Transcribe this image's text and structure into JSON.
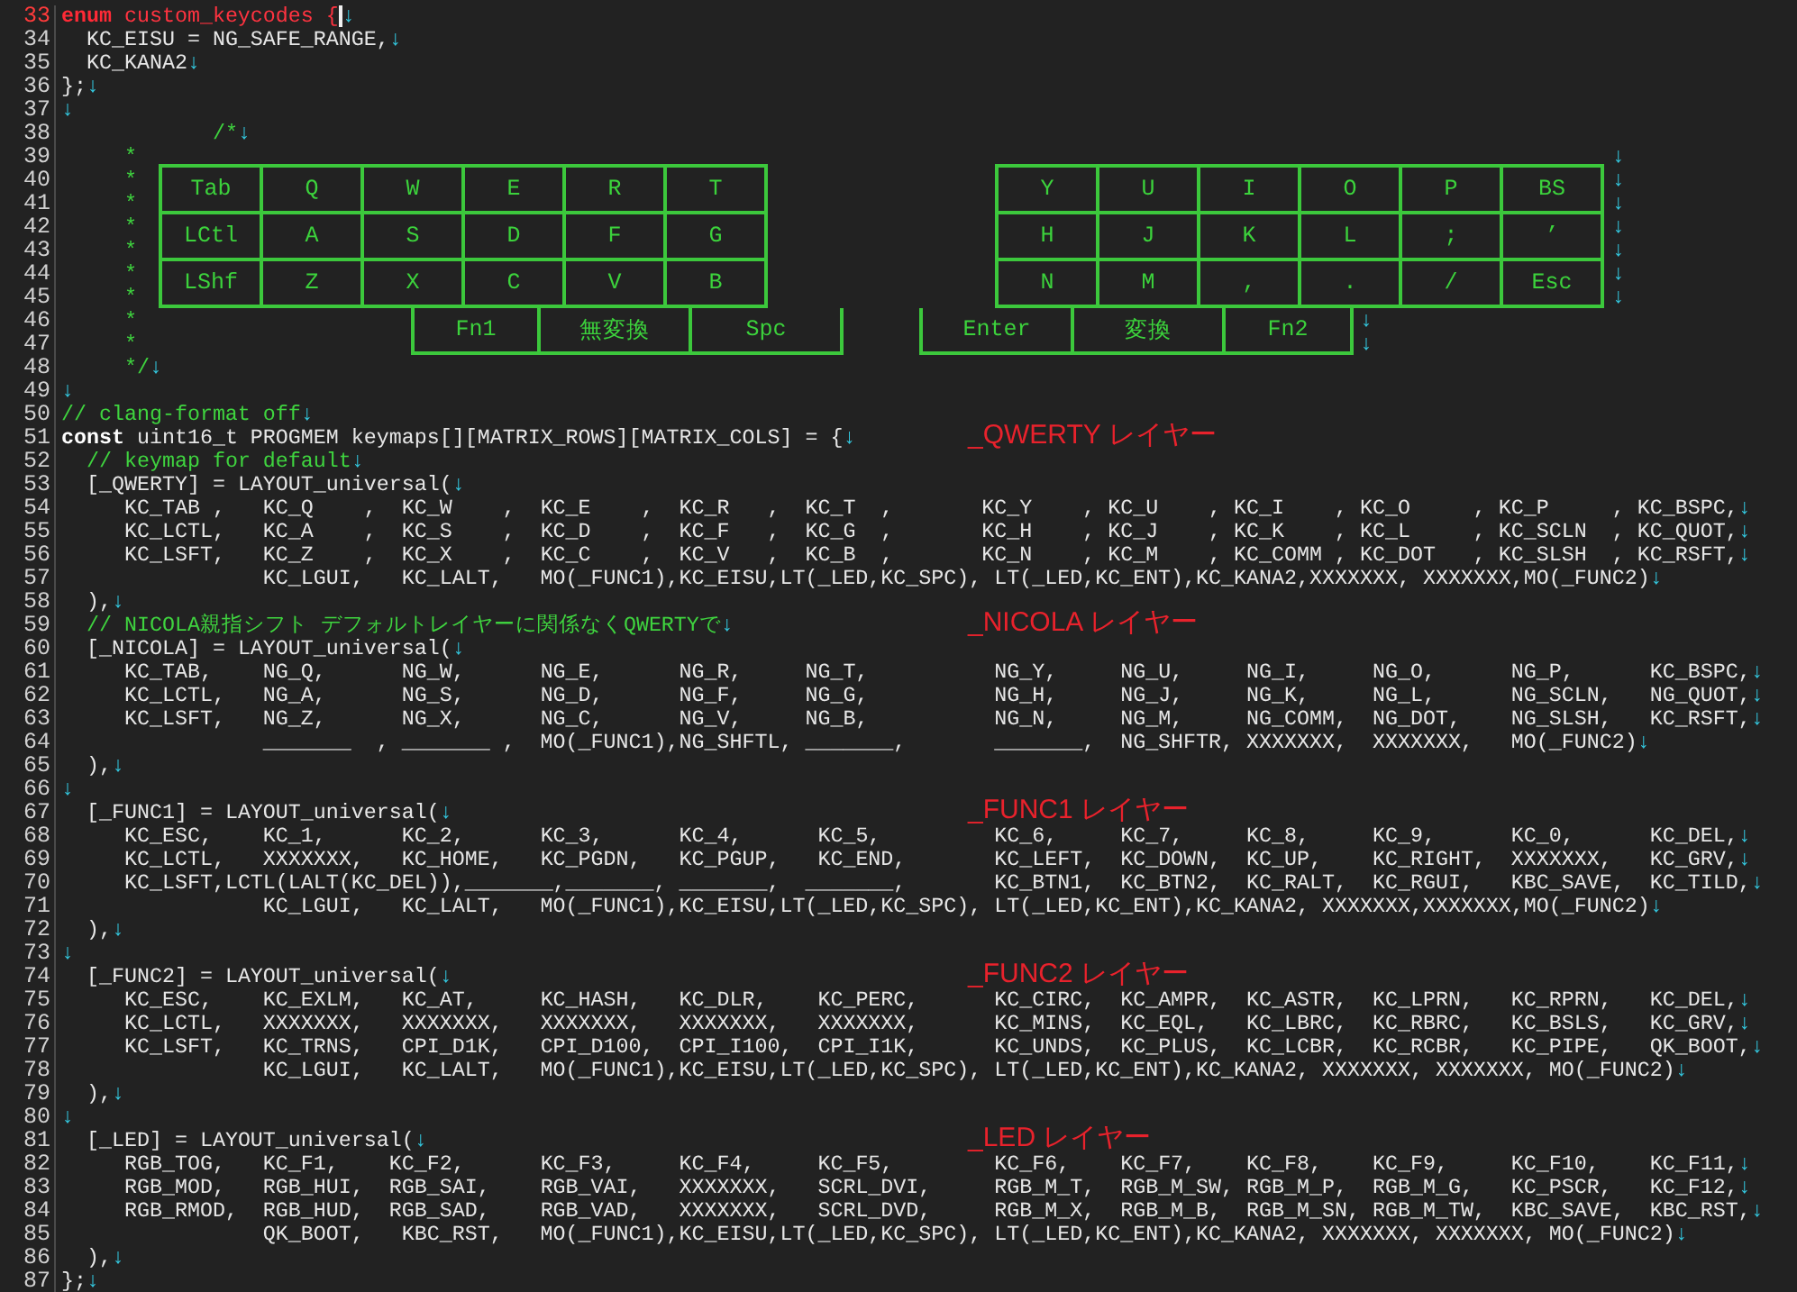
{
  "editor": {
    "lines": [
      {
        "num": "33",
        "current": true,
        "segments": [
          {
            "kind": "red-bold",
            "text": "enum"
          },
          {
            "kind": "red",
            "text": " custom_keycodes {"
          }
        ],
        "eol": "↓"
      },
      {
        "num": "34",
        "current": false,
        "segments": [
          {
            "kind": "plain",
            "text": "  KC_EISU = NG_SAFE_RANGE,"
          }
        ],
        "eol": "↓"
      },
      {
        "num": "35",
        "current": false,
        "segments": [
          {
            "kind": "plain",
            "text": "  KC_KANA2"
          }
        ],
        "eol": "↓"
      },
      {
        "num": "36",
        "current": false,
        "segments": [
          {
            "kind": "plain",
            "text": "};"
          }
        ],
        "eol": "↓"
      },
      {
        "num": "37",
        "current": false,
        "eol": "↓"
      },
      {
        "num": "38",
        "current": false,
        "segments": [
          {
            "kind": "comment",
            "text": "            /*"
          }
        ],
        "eol": "↓"
      },
      {
        "num": "39",
        "current": false,
        "segments": [
          {
            "kind": "comment",
            "text": "     *                                                                                                                     "
          }
        ],
        "eol": "↓"
      },
      {
        "num": "40",
        "current": false,
        "segments": [
          {
            "kind": "comment",
            "text": "     *                                                                                                                     "
          }
        ],
        "eol": "↓"
      },
      {
        "num": "41",
        "current": false,
        "segments": [
          {
            "kind": "comment",
            "text": "     *                                                                                                                     "
          }
        ],
        "eol": "↓"
      },
      {
        "num": "42",
        "current": false,
        "segments": [
          {
            "kind": "comment",
            "text": "     *                                                                                                                     "
          }
        ],
        "eol": "↓"
      },
      {
        "num": "43",
        "current": false,
        "segments": [
          {
            "kind": "comment",
            "text": "     *                                                                                                                     "
          }
        ],
        "eol": "↓"
      },
      {
        "num": "44",
        "current": false,
        "segments": [
          {
            "kind": "comment",
            "text": "     *                                                                                                                     "
          }
        ],
        "eol": "↓"
      },
      {
        "num": "45",
        "current": false,
        "segments": [
          {
            "kind": "comment",
            "text": "     *                                                                                                                     "
          }
        ],
        "eol": "↓"
      },
      {
        "num": "46",
        "current": false,
        "segments": [
          {
            "kind": "comment",
            "text": "     *                                                                                                 "
          }
        ],
        "eol": "↓"
      },
      {
        "num": "47",
        "current": false,
        "segments": [
          {
            "kind": "comment",
            "text": "     *                                                                                                 "
          }
        ],
        "eol": "↓"
      },
      {
        "num": "48",
        "current": false,
        "segments": [
          {
            "kind": "comment",
            "text": "     */"
          }
        ],
        "eol": "↓"
      },
      {
        "num": "49",
        "current": false,
        "eol": "↓"
      },
      {
        "num": "50",
        "current": false,
        "segments": [
          {
            "kind": "comment",
            "text": "// clang-format off"
          }
        ],
        "eol": "↓"
      },
      {
        "num": "51",
        "current": false,
        "segments": [
          {
            "kind": "bold",
            "text": "const"
          },
          {
            "kind": "plain",
            "text": " uint16_t PROGMEM keymaps[][MATRIX_ROWS][MATRIX_COLS] = {"
          }
        ],
        "eol": "↓",
        "note": "_QWERTY レイヤー"
      },
      {
        "num": "52",
        "current": false,
        "segments": [
          {
            "kind": "comment",
            "text": "  // keymap for default"
          }
        ],
        "eol": "↓"
      },
      {
        "num": "53",
        "current": false,
        "segments": [
          {
            "kind": "plain",
            "text": "  [_QWERTY] = LAYOUT_universal("
          }
        ],
        "eol": "↓"
      },
      {
        "num": "54",
        "current": false,
        "segments": [
          {
            "kind": "plain",
            "text": "     KC_TAB ,   KC_Q    ,  KC_W    ,  KC_E    ,  KC_R   ,  KC_T  ,       KC_Y    , KC_U    , KC_I    , KC_O     , KC_P     , KC_BSPC,"
          }
        ],
        "eol": "↓"
      },
      {
        "num": "55",
        "current": false,
        "segments": [
          {
            "kind": "plain",
            "text": "     KC_LCTL,   KC_A    ,  KC_S    ,  KC_D    ,  KC_F   ,  KC_G  ,       KC_H    , KC_J    , KC_K    , KC_L     , KC_SCLN  , KC_QUOT,"
          }
        ],
        "eol": "↓"
      },
      {
        "num": "56",
        "current": false,
        "segments": [
          {
            "kind": "plain",
            "text": "     KC_LSFT,   KC_Z    ,  KC_X    ,  KC_C    ,  KC_V   ,  KC_B  ,       KC_N    , KC_M    , KC_COMM , KC_DOT   , KC_SLSH  , KC_RSFT,"
          }
        ],
        "eol": "↓"
      },
      {
        "num": "57",
        "current": false,
        "segments": [
          {
            "kind": "plain",
            "text": "                KC_LGUI,   KC_LALT,   MO(_FUNC1),KC_EISU,LT(_LED,KC_SPC), LT(_LED,KC_ENT),KC_KANA2,XXXXXXX, XXXXXXX,MO(_FUNC2)"
          }
        ],
        "eol": "↓"
      },
      {
        "num": "58",
        "current": false,
        "segments": [
          {
            "kind": "plain",
            "text": "  ),"
          }
        ],
        "eol": "↓"
      },
      {
        "num": "59",
        "current": false,
        "segments": [
          {
            "kind": "comment",
            "text": "  // NICOLA親指シフト デフォルトレイヤーに関係なくQWERTYで"
          }
        ],
        "eol": "↓",
        "note": "_NICOLA レイヤー"
      },
      {
        "num": "60",
        "current": false,
        "segments": [
          {
            "kind": "plain",
            "text": "  [_NICOLA] = LAYOUT_universal("
          }
        ],
        "eol": "↓"
      },
      {
        "num": "61",
        "current": false,
        "segments": [
          {
            "kind": "plain",
            "text": "     KC_TAB,    NG_Q,      NG_W,      NG_E,      NG_R,     NG_T,          NG_Y,     NG_U,     NG_I,     NG_O,      NG_P,      KC_BSPC,"
          }
        ],
        "eol": "↓"
      },
      {
        "num": "62",
        "current": false,
        "segments": [
          {
            "kind": "plain",
            "text": "     KC_LCTL,   NG_A,      NG_S,      NG_D,      NG_F,     NG_G,          NG_H,     NG_J,     NG_K,     NG_L,      NG_SCLN,   NG_QUOT,"
          }
        ],
        "eol": "↓"
      },
      {
        "num": "63",
        "current": false,
        "segments": [
          {
            "kind": "plain",
            "text": "     KC_LSFT,   NG_Z,      NG_X,      NG_C,      NG_V,     NG_B,          NG_N,     NG_M,     NG_COMM,  NG_DOT,    NG_SLSH,   KC_RSFT,"
          }
        ],
        "eol": "↓"
      },
      {
        "num": "64",
        "current": false,
        "segments": [
          {
            "kind": "plain",
            "text": "                _______  , _______ ,  MO(_FUNC1),NG_SHFTL, _______,       _______,  NG_SHFTR, XXXXXXX,  XXXXXXX,   MO(_FUNC2)"
          }
        ],
        "eol": "↓"
      },
      {
        "num": "65",
        "current": false,
        "segments": [
          {
            "kind": "plain",
            "text": "  ),"
          }
        ],
        "eol": "↓"
      },
      {
        "num": "66",
        "current": false,
        "eol": "↓"
      },
      {
        "num": "67",
        "current": false,
        "segments": [
          {
            "kind": "plain",
            "text": "  [_FUNC1] = LAYOUT_universal("
          }
        ],
        "eol": "↓",
        "note": "_FUNC1 レイヤー"
      },
      {
        "num": "68",
        "current": false,
        "segments": [
          {
            "kind": "plain",
            "text": "     KC_ESC,    KC_1,      KC_2,      KC_3,      KC_4,      KC_5,         KC_6,     KC_7,     KC_8,     KC_9,      KC_0,      KC_DEL,"
          }
        ],
        "eol": "↓"
      },
      {
        "num": "69",
        "current": false,
        "segments": [
          {
            "kind": "plain",
            "text": "     KC_LCTL,   XXXXXXX,   KC_HOME,   KC_PGDN,   KC_PGUP,   KC_END,       KC_LEFT,  KC_DOWN,  KC_UP,    KC_RIGHT,  XXXXXXX,   KC_GRV,"
          }
        ],
        "eol": "↓"
      },
      {
        "num": "70",
        "current": false,
        "segments": [
          {
            "kind": "plain",
            "text": "     KC_LSFT,LCTL(LALT(KC_DEL)),_______,_______, _______,  _______,       KC_BTN1,  KC_BTN2,  KC_RALT,  KC_RGUI,   KBC_SAVE,  KC_TILD,"
          }
        ],
        "eol": "↓"
      },
      {
        "num": "71",
        "current": false,
        "segments": [
          {
            "kind": "plain",
            "text": "                KC_LGUI,   KC_LALT,   MO(_FUNC1),KC_EISU,LT(_LED,KC_SPC), LT(_LED,KC_ENT),KC_KANA2, XXXXXXX,XXXXXXX,MO(_FUNC2)"
          }
        ],
        "eol": "↓"
      },
      {
        "num": "72",
        "current": false,
        "segments": [
          {
            "kind": "plain",
            "text": "  ),"
          }
        ],
        "eol": "↓"
      },
      {
        "num": "73",
        "current": false,
        "eol": "↓"
      },
      {
        "num": "74",
        "current": false,
        "segments": [
          {
            "kind": "plain",
            "text": "  [_FUNC2] = LAYOUT_universal("
          }
        ],
        "eol": "↓",
        "note": "_FUNC2 レイヤー"
      },
      {
        "num": "75",
        "current": false,
        "segments": [
          {
            "kind": "plain",
            "text": "     KC_ESC,    KC_EXLM,   KC_AT,     KC_HASH,   KC_DLR,    KC_PERC,      KC_CIRC,  KC_AMPR,  KC_ASTR,  KC_LPRN,   KC_RPRN,   KC_DEL,"
          }
        ],
        "eol": "↓"
      },
      {
        "num": "76",
        "current": false,
        "segments": [
          {
            "kind": "plain",
            "text": "     KC_LCTL,   XXXXXXX,   XXXXXXX,   XXXXXXX,   XXXXXXX,   XXXXXXX,      KC_MINS,  KC_EQL,   KC_LBRC,  KC_RBRC,   KC_BSLS,   KC_GRV,"
          }
        ],
        "eol": "↓"
      },
      {
        "num": "77",
        "current": false,
        "segments": [
          {
            "kind": "plain",
            "text": "     KC_LSFT,   KC_TRNS,   CPI_D1K,   CPI_D100,  CPI_I100,  CPI_I1K,      KC_UNDS,  KC_PLUS,  KC_LCBR,  KC_RCBR,   KC_PIPE,   QK_BOOT,"
          }
        ],
        "eol": "↓"
      },
      {
        "num": "78",
        "current": false,
        "segments": [
          {
            "kind": "plain",
            "text": "                KC_LGUI,   KC_LALT,   MO(_FUNC1),KC_EISU,LT(_LED,KC_SPC), LT(_LED,KC_ENT),KC_KANA2, XXXXXXX, XXXXXXX, MO(_FUNC2)"
          }
        ],
        "eol": "↓"
      },
      {
        "num": "79",
        "current": false,
        "segments": [
          {
            "kind": "plain",
            "text": "  ),"
          }
        ],
        "eol": "↓"
      },
      {
        "num": "80",
        "current": false,
        "eol": "↓"
      },
      {
        "num": "81",
        "current": false,
        "segments": [
          {
            "kind": "plain",
            "text": "  [_LED] = LAYOUT_universal("
          }
        ],
        "eol": "↓",
        "note": "_LED レイヤー"
      },
      {
        "num": "82",
        "current": false,
        "segments": [
          {
            "kind": "plain",
            "text": "     RGB_TOG,   KC_F1,    KC_F2,      KC_F3,     KC_F4,     KC_F5,        KC_F6,    KC_F7,    KC_F8,    KC_F9,     KC_F10,    KC_F11,"
          }
        ],
        "eol": "↓"
      },
      {
        "num": "83",
        "current": false,
        "segments": [
          {
            "kind": "plain",
            "text": "     RGB_MOD,   RGB_HUI,  RGB_SAI,    RGB_VAI,   XXXXXXX,   SCRL_DVI,     RGB_M_T,  RGB_M_SW, RGB_M_P,  RGB_M_G,   KC_PSCR,   KC_F12,"
          }
        ],
        "eol": "↓"
      },
      {
        "num": "84",
        "current": false,
        "segments": [
          {
            "kind": "plain",
            "text": "     RGB_RMOD,  RGB_HUD,  RGB_SAD,    RGB_VAD,   XXXXXXX,   SCRL_DVD,     RGB_M_X,  RGB_M_B,  RGB_M_SN, RGB_M_TW,  KBC_SAVE,  KBC_RST,"
          }
        ],
        "eol": "↓"
      },
      {
        "num": "85",
        "current": false,
        "segments": [
          {
            "kind": "plain",
            "text": "                QK_BOOT,   KBC_RST,   MO(_FUNC1),KC_EISU,LT(_LED,KC_SPC), LT(_LED,KC_ENT),KC_KANA2, XXXXXXX, XXXXXXX, MO(_FUNC2)"
          }
        ],
        "eol": "↓"
      },
      {
        "num": "86",
        "current": false,
        "segments": [
          {
            "kind": "plain",
            "text": "  ),"
          }
        ],
        "eol": "↓"
      },
      {
        "num": "87",
        "current": false,
        "segments": [
          {
            "kind": "plain",
            "text": "};"
          }
        ],
        "eol": "↓"
      }
    ],
    "keyboard_diagram": {
      "left_rows": [
        [
          "Tab",
          "Q",
          "W",
          "E",
          "R",
          "T"
        ],
        [
          "LCtl",
          "A",
          "S",
          "D",
          "F",
          "G"
        ],
        [
          "LShf",
          "Z",
          "X",
          "C",
          "V",
          "B"
        ]
      ],
      "left_thumbs": [
        "Fn1",
        "無変換",
        "Spc"
      ],
      "right_rows": [
        [
          "Y",
          "U",
          "I",
          "O",
          "P",
          "BS"
        ],
        [
          "H",
          "J",
          "K",
          "L",
          ";",
          "’"
        ],
        [
          "N",
          "M",
          ",",
          ".",
          "/",
          "Esc"
        ]
      ],
      "right_thumbs": [
        "Enter",
        "変換",
        "Fn2"
      ]
    }
  }
}
